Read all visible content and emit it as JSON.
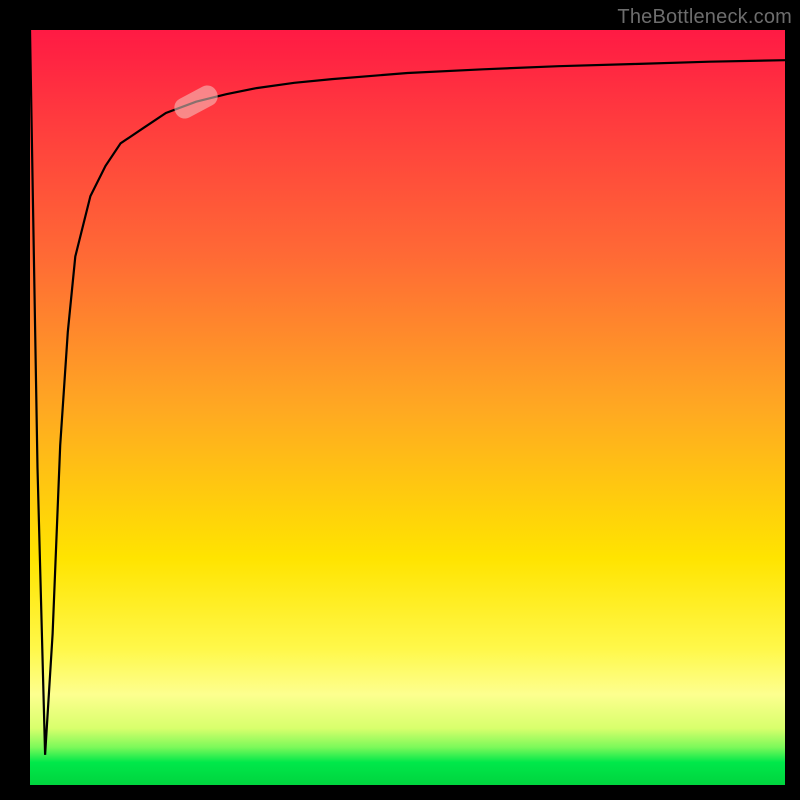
{
  "attribution": "TheBottleneck.com",
  "colors": {
    "frame": "#000000",
    "gradient_top": "#ff1a44",
    "gradient_mid": "#ffe400",
    "gradient_bottom": "#00d43e",
    "curve": "#000000",
    "marker": "rgba(245,200,195,0.56)"
  },
  "chart_data": {
    "type": "line",
    "title": "",
    "xlabel": "",
    "ylabel": "",
    "xlim": [
      0,
      100
    ],
    "ylim": [
      0,
      100
    ],
    "grid": false,
    "legend": false,
    "annotations": [
      "TheBottleneck.com"
    ],
    "series": [
      {
        "name": "curve",
        "x": [
          0,
          1,
          2,
          3,
          4,
          5,
          6,
          8,
          10,
          12,
          15,
          18,
          22,
          26,
          30,
          35,
          40,
          50,
          60,
          70,
          80,
          90,
          100
        ],
        "y": [
          100,
          42,
          4,
          20,
          45,
          60,
          70,
          78,
          82,
          85,
          87,
          89,
          90.5,
          91.5,
          92.3,
          93,
          93.5,
          94.3,
          94.8,
          95.2,
          95.5,
          95.8,
          96
        ]
      }
    ],
    "marker": {
      "x": 22,
      "y": 90.5
    }
  }
}
